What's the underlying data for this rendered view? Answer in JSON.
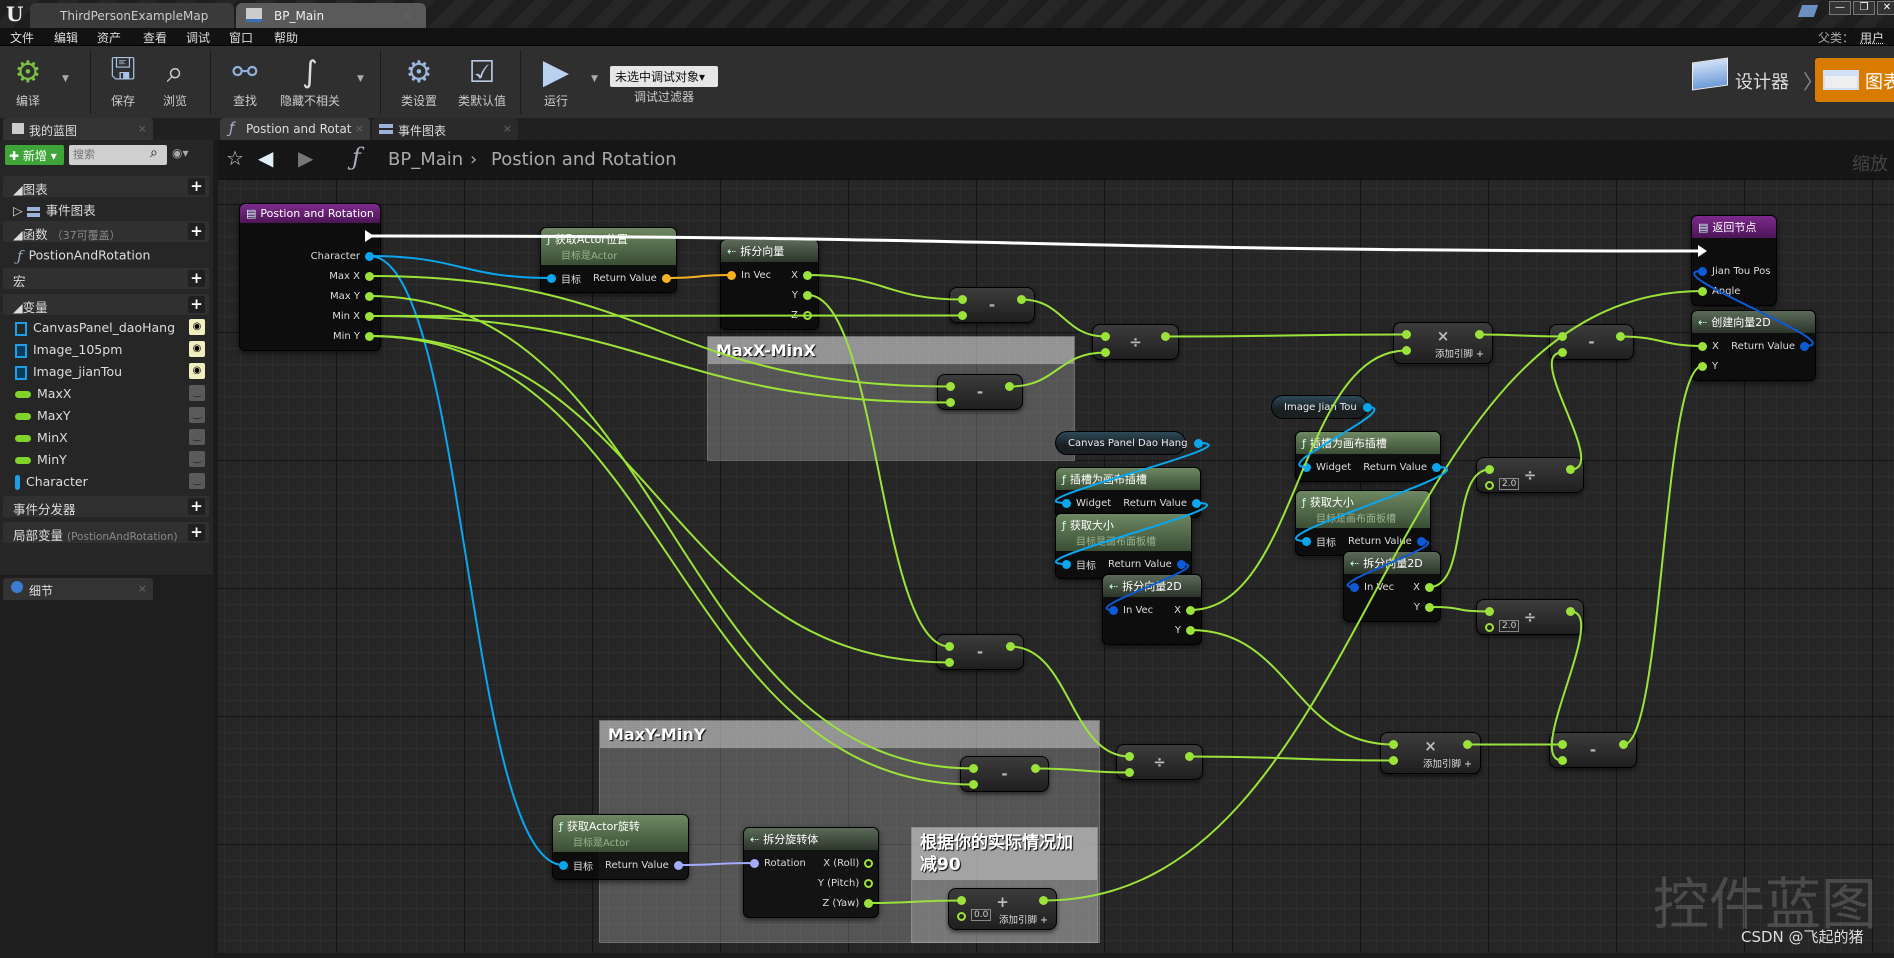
{
  "window": {
    "tabs": [
      "ThirdPersonExampleMap",
      "BP_Main"
    ],
    "parent_label": "父类：",
    "parent_value": "用户控"
  },
  "menu": [
    "文件",
    "编辑",
    "资产",
    "查看",
    "调试",
    "窗口",
    "帮助"
  ],
  "toolbar": {
    "compile": "编译",
    "save": "保存",
    "browse": "浏览",
    "find": "查找",
    "hide_unrelated": "隐藏不相关",
    "class_settings": "类设置",
    "class_defaults": "类默认值",
    "run": "运行",
    "debug_object": "未选中调试对象▾",
    "debug_filter": "调试过滤器",
    "designer": "设计器",
    "graph": "图表"
  },
  "panel_tabs": {
    "my_blueprint": "我的蓝图",
    "details": "细节",
    "graph_tabs": [
      "Postion and Rotat",
      "事件图表"
    ]
  },
  "my_blueprint": {
    "add_new": "新增",
    "search_placeholder": "搜索",
    "graphs": "图表",
    "event_graph": "事件图表",
    "functions": "函数",
    "functions_note": "（37可覆盖）",
    "function_item": "PostionAndRotation",
    "macros": "宏",
    "variables": "变量",
    "variable_items": [
      {
        "name": "CanvasPanel_daoHang",
        "type": "widget",
        "visible": true
      },
      {
        "name": "Image_105pm",
        "type": "image",
        "visible": true
      },
      {
        "name": "Image_jianTou",
        "type": "image",
        "visible": true
      },
      {
        "name": "MaxX",
        "type": "float",
        "visible": false
      },
      {
        "name": "MaxY",
        "type": "float",
        "visible": false
      },
      {
        "name": "MinX",
        "type": "float",
        "visible": false
      },
      {
        "name": "MinY",
        "type": "float",
        "visible": false
      },
      {
        "name": "Character",
        "type": "object",
        "visible": false
      }
    ],
    "event_dispatchers": "事件分发器",
    "local_variables": "局部变量",
    "local_note": "(PostionAndRotation)"
  },
  "breadcrumb": {
    "root": "BP_Main",
    "current": "Postion and Rotation",
    "zoom": "缩放"
  },
  "colors": {
    "float": "#9be33a",
    "object": "#0aa6ee",
    "vector": "#f5b221",
    "vector2d": "#0d5ad6",
    "rotator": "#a4acff",
    "exec": "#ffffff",
    "accent": "#d97b00"
  },
  "graph": {
    "comments": [
      {
        "id": "c1",
        "text": "MaxX-MinX"
      },
      {
        "id": "c2",
        "text": "MaxY-MinY"
      },
      {
        "id": "c3",
        "text": "根据你的实际情况加减90"
      }
    ],
    "nodes": [
      {
        "id": "entry",
        "kind": "entry",
        "title": "Postion and Rotation",
        "inputs": [],
        "outputs": [
          {
            "label": "",
            "type": "exec"
          },
          {
            "label": "Character",
            "type": "object"
          },
          {
            "label": "Max X",
            "type": "float"
          },
          {
            "label": "Max Y",
            "type": "float"
          },
          {
            "label": "Min X",
            "type": "float"
          },
          {
            "label": "Min Y",
            "type": "float"
          }
        ]
      },
      {
        "id": "getloc",
        "kind": "fn",
        "title": "获取Actor位置",
        "subtitle": "目标是Actor",
        "inputs": [
          {
            "label": "目标",
            "type": "object"
          }
        ],
        "outputs": [
          {
            "label": "Return Value",
            "type": "vector"
          }
        ]
      },
      {
        "id": "breakvec",
        "kind": "struct",
        "title": "拆分向量",
        "inputs": [
          {
            "label": "In Vec",
            "type": "vector"
          }
        ],
        "outputs": [
          {
            "label": "X",
            "type": "float"
          },
          {
            "label": "Y",
            "type": "float"
          },
          {
            "label": "Z",
            "type": "float",
            "hollow": true
          }
        ]
      },
      {
        "id": "ret",
        "kind": "entry",
        "title": "返回节点",
        "inputs": [
          {
            "label": "",
            "type": "exec"
          },
          {
            "label": "Jian Tou Pos",
            "type": "vector2d"
          },
          {
            "label": "Angle",
            "type": "float"
          }
        ],
        "outputs": []
      },
      {
        "id": "make2d",
        "kind": "struct",
        "title": "创建向量2D",
        "inputs": [
          {
            "label": "X",
            "type": "float"
          },
          {
            "label": "Y",
            "type": "float"
          }
        ],
        "outputs": [
          {
            "label": "Return Value",
            "type": "vector2d"
          }
        ]
      },
      {
        "id": "slotR",
        "kind": "fn",
        "title": "插槽为画布插槽",
        "inputs": [
          {
            "label": "Widget",
            "type": "object"
          }
        ],
        "outputs": [
          {
            "label": "Return Value",
            "type": "object"
          }
        ]
      },
      {
        "id": "sizeR",
        "kind": "fn",
        "title": "获取大小",
        "subtitle": "目标是画布面板槽",
        "inputs": [
          {
            "label": "目标",
            "type": "object"
          }
        ],
        "outputs": [
          {
            "label": "Return Value",
            "type": "vector2d"
          }
        ]
      },
      {
        "id": "split2dR",
        "kind": "struct",
        "title": "拆分向量2D",
        "inputs": [
          {
            "label": "In Vec",
            "type": "vector2d"
          }
        ],
        "outputs": [
          {
            "label": "X",
            "type": "float"
          },
          {
            "label": "Y",
            "type": "float"
          }
        ]
      },
      {
        "id": "slotL",
        "kind": "fn",
        "title": "插槽为画布插槽",
        "inputs": [
          {
            "label": "Widget",
            "type": "object"
          }
        ],
        "outputs": [
          {
            "label": "Return Value",
            "type": "object"
          }
        ]
      },
      {
        "id": "sizeL",
        "kind": "fn",
        "title": "获取大小",
        "subtitle": "目标是画布面板槽",
        "inputs": [
          {
            "label": "目标",
            "type": "object"
          }
        ],
        "outputs": [
          {
            "label": "Return Value",
            "type": "vector2d"
          }
        ]
      },
      {
        "id": "split2dL",
        "kind": "struct",
        "title": "拆分向量2D",
        "inputs": [
          {
            "label": "In Vec",
            "type": "vector2d"
          }
        ],
        "outputs": [
          {
            "label": "X",
            "type": "float"
          },
          {
            "label": "Y",
            "type": "float"
          }
        ]
      },
      {
        "id": "getrot",
        "kind": "fn",
        "title": "获取Actor旋转",
        "subtitle": "目标是Actor",
        "inputs": [
          {
            "label": "目标",
            "type": "object"
          }
        ],
        "outputs": [
          {
            "label": "Return Value",
            "type": "rotator"
          }
        ]
      },
      {
        "id": "breakrot",
        "kind": "struct",
        "title": "拆分旋转体",
        "inputs": [
          {
            "label": "Rotation",
            "type": "rotator"
          }
        ],
        "outputs": [
          {
            "label": "X (Roll)",
            "type": "float",
            "hollow": true
          },
          {
            "label": "Y (Pitch)",
            "type": "float",
            "hollow": true
          },
          {
            "label": "Z (Yaw)",
            "type": "float"
          }
        ]
      }
    ],
    "variables": [
      {
        "id": "imgvar",
        "label": "Image Jian Tou"
      },
      {
        "id": "canvasvar",
        "label": "Canvas Panel Dao Hang"
      }
    ],
    "operators": [
      {
        "id": "sub1",
        "symbol": "-"
      },
      {
        "id": "sub2",
        "symbol": "-"
      },
      {
        "id": "div1",
        "symbol": "÷"
      },
      {
        "id": "mul1",
        "symbol": "×",
        "add_pin": "添加引脚 +"
      },
      {
        "id": "sub3",
        "symbol": "-"
      },
      {
        "id": "divTop",
        "symbol": "÷",
        "literal": "2.0"
      },
      {
        "id": "divBot",
        "symbol": "÷",
        "literal": "2.0"
      },
      {
        "id": "subMid",
        "symbol": "-"
      },
      {
        "id": "subC2",
        "symbol": "-"
      },
      {
        "id": "div2",
        "symbol": "÷"
      },
      {
        "id": "mul2",
        "symbol": "×",
        "add_pin": "添加引脚 +"
      },
      {
        "id": "sub4",
        "symbol": "-"
      },
      {
        "id": "add",
        "symbol": "+",
        "literal": "0.0",
        "add_pin": "添加引脚 +"
      }
    ]
  },
  "watermark": {
    "big": "控件蓝图",
    "credit": "CSDN @飞起的猪"
  }
}
